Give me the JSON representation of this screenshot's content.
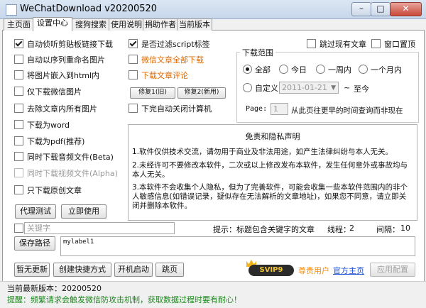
{
  "window": {
    "title": "WeChatDownload v20200520",
    "minimize_glyph": "–",
    "maximize_glyph": "□",
    "close_glyph": "✕"
  },
  "tabs": [
    {
      "label": "主页面",
      "active": false
    },
    {
      "label": "设置中心",
      "active": true
    },
    {
      "label": "搜狗搜索",
      "active": false
    },
    {
      "label": "使用说明",
      "active": false
    },
    {
      "label": "捐助作者",
      "active": false
    },
    {
      "label": "当前版本",
      "active": false
    }
  ],
  "left_options": [
    {
      "label": "自动侦听剪贴板链接下载",
      "checked": true
    },
    {
      "label": "自动以序列重命名图片",
      "checked": false
    },
    {
      "label": "将图片嵌入到html内",
      "checked": false
    },
    {
      "label": "仅下载微信图片",
      "checked": false
    },
    {
      "label": "去除文章内所有图片",
      "checked": false
    },
    {
      "label": "下载为word",
      "checked": false
    },
    {
      "label": "下载为pdf(推荐)",
      "checked": false
    },
    {
      "label": "同时下载音频文件(Beta)",
      "checked": false
    },
    {
      "label": "同时下载视频文件(Alpha)",
      "checked": false,
      "disabled": true
    },
    {
      "label": "只下载原创文章",
      "checked": false
    }
  ],
  "mid_options": {
    "filter_script": {
      "label": "是否过滤script标签",
      "checked": true
    },
    "download_all": {
      "label": "微信文章全部下载",
      "checked": false
    },
    "download_comments": {
      "label": "下载文章评论",
      "checked": false
    },
    "fix1": "修复1(旧)",
    "fix2": "修复2(新用)",
    "shutdown": {
      "label": "下完自动关闭计算机",
      "checked": false
    }
  },
  "top_right": {
    "skip_existing": {
      "label": "跳过现有文章",
      "checked": false
    },
    "window_topmost": {
      "label": "窗口置顶",
      "checked": false
    }
  },
  "range": {
    "legend": "下载范围",
    "options": [
      "全部",
      "今日",
      "一周内",
      "一个月内"
    ],
    "selected": "全部",
    "custom_label": "自定义",
    "custom_date": "2011-01-21",
    "to_label": "至今",
    "tilde": "~",
    "page_label": "Page:",
    "page_value": "1",
    "page_hint": "从此页往更早的时间查询而非现在"
  },
  "disclaimer": {
    "title": "免责和隐私声明",
    "p1": "1.软件仅供技术交流，请勿用于商业及非法用途，如产生法律纠纷与本人无关。",
    "p2": "2.未经许可不要修改本软件，二次或以上修改发布本软件，发生任何意外或事故均与本人无关。",
    "p3": "3.本软件不会收集个人隐私，但为了完善软件，可能会收集一些本软件范围内的非个人敏感信息(如错误记录，疑似存在无法解析的文章地址)，如果您不同意，请立即关闭并删除本软件。"
  },
  "proxy_test": "代理测试",
  "apply_now": "立即使用",
  "keyword": {
    "placeholder": "关键字",
    "hint": "提示：标题包含关键字的文章",
    "threads_label": "线程：",
    "threads": "2",
    "interval_label": "间隔：",
    "interval": "10"
  },
  "save_path": {
    "button": "保存路径",
    "value": "mylabel1"
  },
  "actions": {
    "no_update": "暂无更新",
    "create_shortcut": "创建快捷方式",
    "startup": "开机启动",
    "jump_page": "跳页",
    "vip_user": "尊贵用户",
    "homepage": "官方主页",
    "apply_config": "应用配置",
    "svip": "SVIP9"
  },
  "status": {
    "version": "当前最新版本：20200520",
    "tip": "提醒：频繁请求会触发微信防攻击机制，获取数据过程时要有耐心！"
  },
  "colors": {
    "accent_orange": "#e06a00",
    "link_blue": "#1a4fd6",
    "vip_orange": "#ff8a00",
    "tip_green": "#1a8a1a"
  }
}
